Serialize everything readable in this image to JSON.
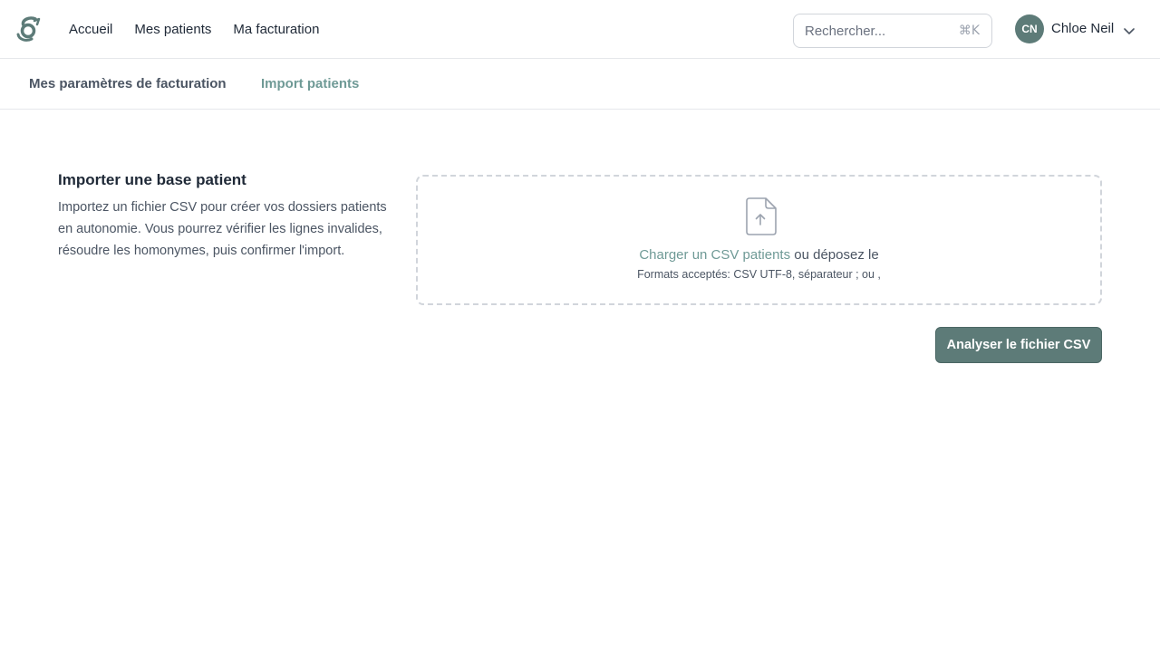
{
  "header": {
    "logo_icon": "brand-logo-icon",
    "nav": [
      {
        "label": "Accueil"
      },
      {
        "label": "Mes patients"
      },
      {
        "label": "Ma facturation"
      }
    ],
    "search": {
      "placeholder": "Rechercher...",
      "value": "",
      "shortcut": "⌘K"
    },
    "user": {
      "initials": "CN",
      "name": "Chloe Neil",
      "menu_icon": "chevron-down-icon"
    }
  },
  "subnav": {
    "tabs": [
      {
        "label": "Mes paramètres de facturation",
        "active": false
      },
      {
        "label": "Import patients",
        "active": true
      }
    ]
  },
  "import": {
    "title": "Importer une base patient",
    "description": "Importez un fichier CSV pour créer vos dossiers patients en autonomie. Vous pourrez vérifier les lignes invalides, résoudre les homonymes, puis confirmer l'import.",
    "dropzone": {
      "icon": "file-upload-icon",
      "link_label": "Charger un CSV patients",
      "drop_text": "ou déposez le",
      "formats": "Formats acceptés: CSV UTF-8, séparateur ; ou ,"
    },
    "analyze_label": "Analyser le fichier CSV"
  },
  "colors": {
    "brand": "#5d7b78",
    "accent_text": "#6f9a96",
    "border": "#e5e7eb"
  }
}
